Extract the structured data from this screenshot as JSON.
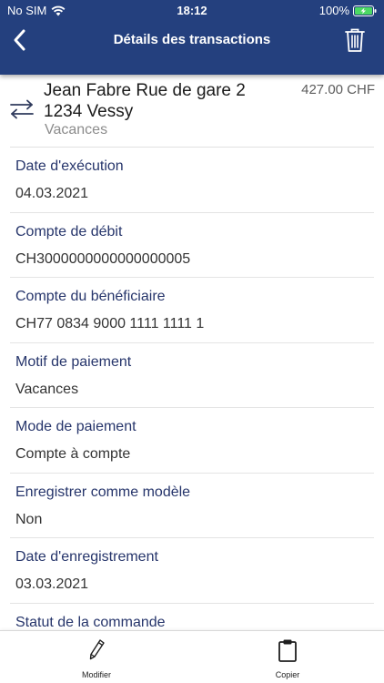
{
  "status_bar": {
    "carrier": "No SIM",
    "time": "18:12",
    "battery_percent": "100%"
  },
  "nav": {
    "title": "Détails des transactions",
    "back_icon": "chevron-left-icon",
    "delete_icon": "trash-icon"
  },
  "transaction": {
    "recipient_line1": "Jean Fabre Rue de gare 2",
    "recipient_line2": "1234 Vessy",
    "category": "Vacances",
    "amount": "427.00 CHF",
    "icon": "transfer-arrows-icon"
  },
  "details": [
    {
      "label": "Date d'exécution",
      "value": "04.03.2021"
    },
    {
      "label": "Compte de débit",
      "value": "CH3000000000000000005"
    },
    {
      "label": "Compte du bénéficiaire",
      "value": "CH77 0834 9000 1111 1111 1"
    },
    {
      "label": "Motif de paiement",
      "value": "Vacances"
    },
    {
      "label": "Mode de paiement",
      "value": "Compte à compte"
    },
    {
      "label": "Enregistrer comme modèle",
      "value": "Non"
    },
    {
      "label": "Date d'enregistrement",
      "value": "03.03.2021"
    },
    {
      "label": "Statut de la commande",
      "value": ""
    }
  ],
  "toolbar": {
    "edit_label": "Modifier",
    "copy_label": "Copier"
  },
  "colors": {
    "header_bg": "#24407e",
    "label_text": "#26356b",
    "battery_fill": "#4cd964"
  }
}
